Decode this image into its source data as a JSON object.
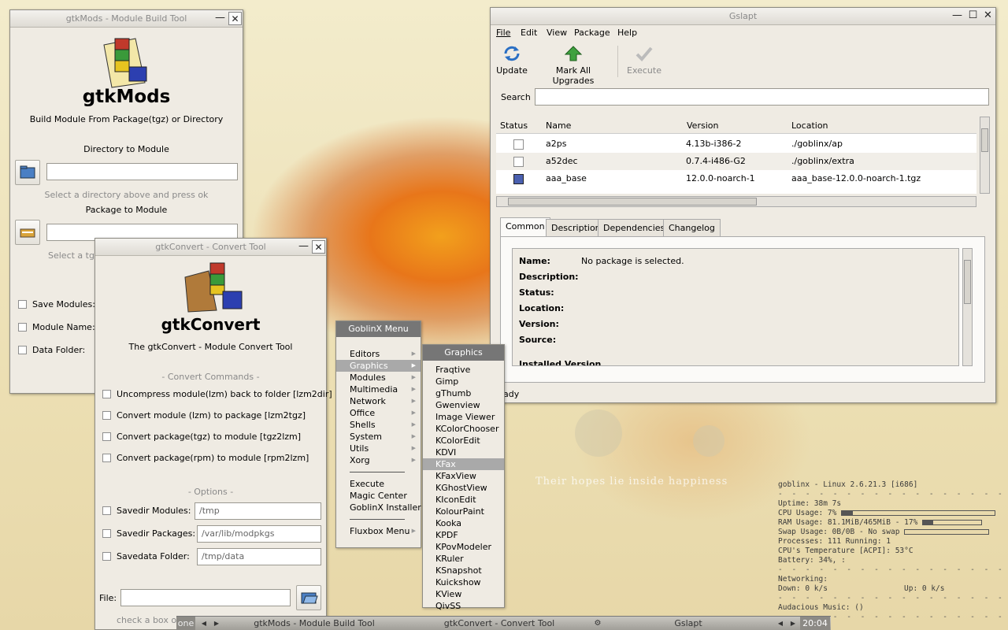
{
  "gtkmods": {
    "title": "gtkMods - Module Build Tool",
    "app_name": "gtkMods",
    "subtitle": "Build Module From Package(tgz) or Directory",
    "dir_heading": "Directory to Module",
    "dir_hint": "Select a directory above and press ok",
    "pkg_heading": "Package to Module",
    "pkg_hint": "Select a tgz",
    "save_modules": "Save Modules:",
    "module_name": "Module Name:",
    "data_folder": "Data Folder:"
  },
  "gtkconvert": {
    "title": "gtkConvert - Convert Tool",
    "app_name": "gtkConvert",
    "subtitle": "The gtkConvert - Module Convert Tool",
    "commands_heading": "- Convert Commands -",
    "commands": [
      "Uncompress module(lzm) back to folder [lzm2dir]",
      "Convert module (lzm) to package [lzm2tgz]",
      "Convert package(tgz) to module [tgz2lzm]",
      "Convert package(rpm) to module [rpm2lzm]"
    ],
    "options_heading": "- Options -",
    "opt_savedir_modules": "Savedir Modules:",
    "opt_savedir_modules_val": "/tmp",
    "opt_savedir_packages": "Savedir Packages:",
    "opt_savedir_packages_val": "/var/lib/modpkgs",
    "opt_savedata_folder": "Savedata Folder:",
    "opt_savedata_folder_val": "/tmp/data",
    "file_label": "File:",
    "footer_hint": "check a box opti"
  },
  "gslapt": {
    "title": "Gslapt",
    "menu": [
      "File",
      "Edit",
      "View",
      "Package",
      "Help"
    ],
    "toolbar": {
      "update": "Update",
      "mark_all": "Mark All Upgrades",
      "execute": "Execute"
    },
    "search_label": "Search",
    "columns": [
      "Status",
      "Name",
      "Version",
      "Location"
    ],
    "rows": [
      {
        "name": "a2ps",
        "version": "4.13b-i386-2",
        "location": "./goblinx/ap",
        "installed": false
      },
      {
        "name": "a52dec",
        "version": "0.7.4-i486-G2",
        "location": "./goblinx/extra",
        "installed": false
      },
      {
        "name": "aaa_base",
        "version": "12.0.0-noarch-1",
        "location": "aaa_base-12.0.0-noarch-1.tgz",
        "installed": true
      }
    ],
    "tabs": [
      "Common",
      "Description",
      "Dependencies",
      "Changelog"
    ],
    "info": {
      "name_label": "Name:",
      "name_value": "No package is selected.",
      "description_label": "Description:",
      "status_label": "Status:",
      "location_label": "Location:",
      "version_label": "Version:",
      "source_label": "Source:",
      "installed_label": "Installed Version"
    },
    "status_text": "ady"
  },
  "goblin_menu": {
    "title": "GoblinX Menu",
    "items": [
      "Editors",
      "Graphics",
      "Modules",
      "Multimedia",
      "Network",
      "Office",
      "Shells",
      "System",
      "Utils",
      "Xorg"
    ],
    "actions": [
      "Execute",
      "Magic Center",
      "GoblinX Installer"
    ],
    "fluxbox": "Fluxbox Menu"
  },
  "graphics_menu": {
    "title": "Graphics",
    "items": [
      "Fraqtive",
      "Gimp",
      "gThumb",
      "Gwenview",
      "Image Viewer",
      "KColorChooser",
      "KColorEdit",
      "KDVI",
      "KFax",
      "KFaxView",
      "KGhostView",
      "KIconEdit",
      "KolourPaint",
      "Kooka",
      "KPDF",
      "KPovModeler",
      "KRuler",
      "KSnapshot",
      "Kuickshow",
      "KView",
      "QivSS"
    ],
    "selected": "KFax"
  },
  "conky": {
    "header": "goblinx - Linux 2.6.21.3 [i686]",
    "uptime": "Uptime: 38m 7s",
    "cpu": "CPU Usage: 7%",
    "cpu_level": 0.07,
    "ram": "RAM Usage: 81.1MiB/465MiB - 17%",
    "ram_level": 0.17,
    "swap": "Swap Usage: 0B/0B - No swap",
    "swap_level": 0,
    "processes": "Processes: 111  Running: 1",
    "temp": "CPU's Temperature [ACPI]:  53°C",
    "battery": "Battery:  34%, :",
    "networking": "Networking:",
    "down": " Down: 0 k/s",
    "up": "Up: 0 k/s",
    "music": "Audacious Music:  ()"
  },
  "taskbar": {
    "workspace": "one",
    "tasks": [
      "gtkMods - Module Build Tool",
      "gtkConvert - Convert Tool",
      "Gslapt"
    ],
    "clock": "20:04"
  },
  "wallpaper_text": "Their hopes lie inside happiness",
  "colors": {
    "selection": "#a9a9a9",
    "menu_title": "#767676",
    "wallpaper_orange": "#e8761a"
  }
}
